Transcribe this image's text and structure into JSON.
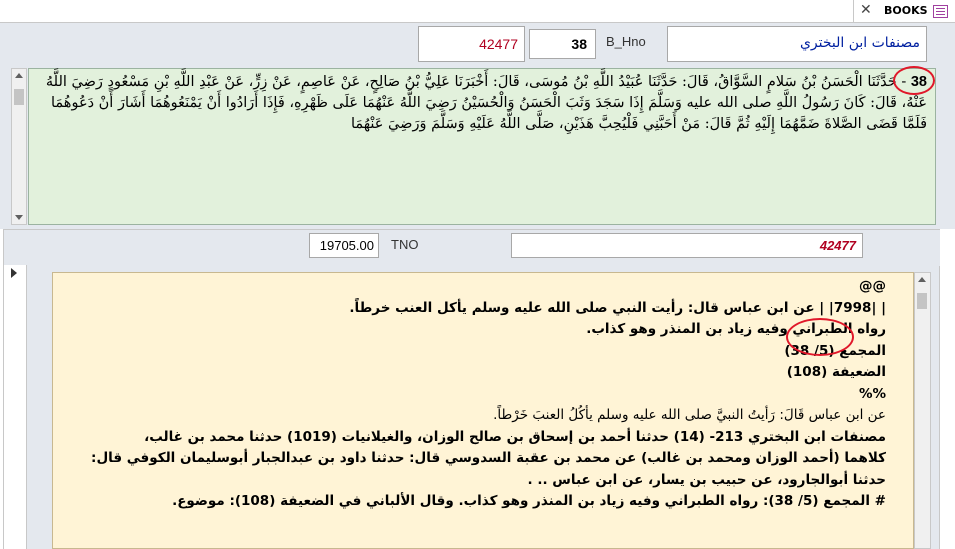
{
  "tab": {
    "close_glyph": "✕",
    "title": "BOOKS"
  },
  "header": {
    "book_title": "مصنفات ابن البختري",
    "hno_label": "B_Hno",
    "hno_value": "38",
    "record_id": "42477"
  },
  "hadith": {
    "number": "38",
    "sep": " - ",
    "text": "حَدَّثَنَا الْحَسَنُ بْنُ سَلامٍ السَّوَّاقُ، قَالَ: حَدَّثَنَا عُبَيْدُ اللَّهِ بْنُ مُوسَى، قَالَ: أَخْبَرَنَا عَلِيُّ بْنُ صَالِحٍ، عَنْ عَاصِمٍ، عَنْ زِرٍّ، عَنْ عَبْدِ اللَّهِ بْنِ مَسْعُودٍ رَضِيَ اللَّهُ عَنْهُ، قَالَ: كَانَ رَسُولُ اللَّهِ صلى الله عليه وَسَلَّمَ إِذَا سَجَدَ وَثَبَ الْحَسَنُ وَالْحُسَيْنُ رَضِيَ اللَّهُ عَنْهُمَا عَلَى ظَهْرِهِ، فَإِذَا أَرَادُوا أَنْ يَمْنَعُوهُمَا أَشَارَ أَنْ دَعُوهُمَا فَلَمَّا قَضَى الصَّلاةَ ضَمَّهُمَا إِلَيْهِ ثُمَّ قَالَ: مَنْ أَحَبَّنِي فَلْيُحِبَّ هَذَيْنِ، صَلَّى اللَّهُ عَلَيْهِ وَسَلَّمَ وَرَضِيَ عَنْهُمَا"
  },
  "subform": {
    "tno_label": "TNO",
    "tno_value": "19705.00",
    "record_id": "42477"
  },
  "takhrij": {
    "l1": "@@",
    "l2": "| |7998| | عن ابن عباس قال: رأيت النبي صلى الله عليه وسلم يأكل العنب خرطاً.",
    "l3": "رواه الطبراني وفيه زياد بن المنذر وهو كذاب.",
    "l4": "المجمع (5/ 38)",
    "l5": "الضعيفة (108)",
    "l6": "%%",
    "l7": "عن ابن عباس قَالَ: رَأَيتُ النبيَّ صلى الله عليه وسلم يأكُلُ العنبَ خَرْطاً.",
    "l8": "مصنفات ابن البختري 213- (14) حدثنا أحمد بن إسحاق بن صالح الوزان، والغيلانيات (1019) حدثنا محمد بن غالب،",
    "l9": "كلاهما (أحمد الوزان ومحمد بن غالب) عن محمد بن عقبة السدوسي قال: حدثنا داود بن عبدالجبار أبوسليمان الكوفي قال: حدثنا أبوالجارود، عن حبيب بن يسار، عن ابن عباس .. .",
    "l10": "# المجمع (5/ 38): رواه الطبراني وفيه زياد بن المنذر وهو كذاب. وقال الألباني في الضعيفة (108): موضوع."
  },
  "colors": {
    "green_bg": "#e2f1dc",
    "cream_bg": "#fff4d6",
    "record_red": "#b00020",
    "annotation_red": "#e0182a"
  }
}
